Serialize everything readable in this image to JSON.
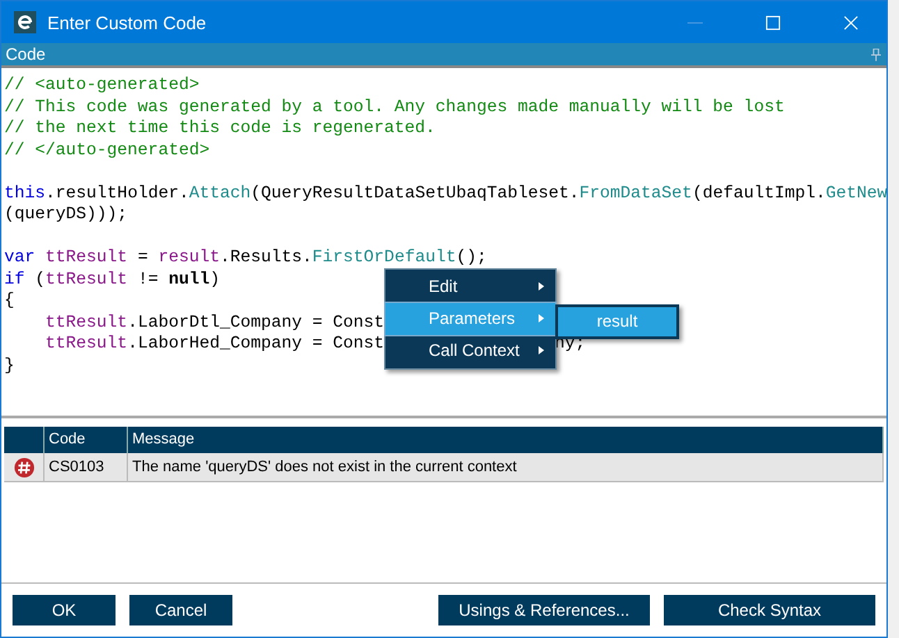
{
  "window": {
    "title": "Enter Custom Code"
  },
  "panel": {
    "title": "Code",
    "pinned": true
  },
  "code_blocks": [
    [
      [
        {
          "kind": "comment",
          "text": "// <auto-generated>"
        }
      ],
      [
        {
          "kind": "comment",
          "text": "// This code was generated by a tool. Any changes made manually will be lost"
        }
      ],
      [
        {
          "kind": "comment",
          "text": "// the next time this code is regenerated."
        }
      ],
      [
        {
          "kind": "comment",
          "text": "// </auto-generated>"
        }
      ]
    ],
    [
      [
        {
          "kind": "keyword",
          "text": "this"
        },
        {
          "kind": "plain",
          "text": ".resultHolder."
        },
        {
          "kind": "method",
          "text": "Attach"
        },
        {
          "kind": "plain",
          "text": "(QueryResultDataSetUbaqTableset."
        },
        {
          "kind": "method",
          "text": "FromDataSet"
        },
        {
          "kind": "plain",
          "text": "(defaultImpl."
        },
        {
          "kind": "method",
          "text": "GetNew"
        }
      ],
      [
        {
          "kind": "plain",
          "text": "(queryDS)));"
        }
      ]
    ],
    [
      [
        {
          "kind": "keyword",
          "text": "var"
        },
        {
          "kind": "variable",
          "text": " ttResult"
        },
        {
          "kind": "plain",
          "text": " = "
        },
        {
          "kind": "variable",
          "text": "result"
        },
        {
          "kind": "plain",
          "text": ".Results."
        },
        {
          "kind": "method",
          "text": "FirstOrDefault"
        },
        {
          "kind": "plain",
          "text": "();"
        }
      ],
      [
        {
          "kind": "keyword",
          "text": "if"
        },
        {
          "kind": "plain",
          "text": " ("
        },
        {
          "kind": "variable",
          "text": "ttResult"
        },
        {
          "kind": "plain",
          "text": " != "
        },
        {
          "kind": "bold",
          "text": "null"
        },
        {
          "kind": "plain",
          "text": ")"
        }
      ],
      [
        {
          "kind": "plain",
          "text": "{"
        }
      ],
      [
        {
          "kind": "variable",
          "text": "    ttResult"
        },
        {
          "kind": "plain",
          "text": ".LaborDtl_Company = Const"
        }
      ],
      [
        {
          "kind": "variable",
          "text": "    ttResult"
        },
        {
          "kind": "plain",
          "text": ".LaborHed_Company = Const"
        },
        {
          "kind": "resumed",
          "text": "ny;"
        }
      ],
      [
        {
          "kind": "plain",
          "text": "}"
        }
      ]
    ]
  ],
  "context_menu": {
    "items": [
      {
        "label": "Edit",
        "selected": false
      },
      {
        "label": "Parameters",
        "selected": true
      },
      {
        "label": "Call Context",
        "selected": false
      }
    ],
    "submenu": {
      "items": [
        {
          "label": "result",
          "selected": true
        }
      ]
    }
  },
  "errors": {
    "columns": [
      "Code",
      "Message"
    ],
    "rows": [
      {
        "kind": "error",
        "code": "CS0103",
        "message": "The name 'queryDS' does not exist in the current context"
      }
    ]
  },
  "buttons_left": [
    "OK",
    "Cancel"
  ],
  "buttons_right": [
    "Usings & References...",
    "Check Syntax"
  ]
}
